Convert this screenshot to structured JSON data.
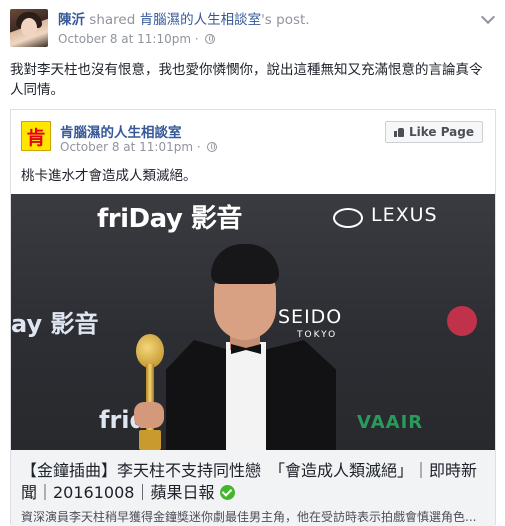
{
  "post": {
    "author": "陳沂",
    "shared_word": "shared",
    "shared_page": "肯腦濕的人生相談室",
    "post_suffix": "'s post.",
    "timestamp": "October 8 at 11:10pm",
    "privacy_icon": "globe-icon",
    "text": "我對李天柱也沒有恨意，我也愛你憐憫你，說出這種無知又充滿恨意的言論真令人同情。"
  },
  "shared": {
    "page_logo_text": "肯",
    "page_name": "肯腦濕的人生相談室",
    "timestamp": "October 8 at 11:01pm",
    "like_label": "Like Page",
    "text": "桃卡進水才會造成人類滅絕。",
    "photo_text": {
      "friday1": "friDay 影音",
      "lexus": "LEXUS",
      "friday2": "ay 影音",
      "seido": "SEIDO",
      "tokyo": "TOKYO",
      "friday3": "frid",
      "evaair": "VAAIR"
    },
    "link_title": "【金鐘插曲】李天柱不支持同性戀　「會造成人類滅絕」｜即時新聞｜20161008｜蘋果日報",
    "link_desc": "資深演員李天柱稍早獲得金鐘獎迷你劇最佳男主角，他在受訪時表示拍戲會慎選角色..."
  },
  "colors": {
    "link_blue": "#365899",
    "muted": "#90949c",
    "verified_green": "#42b72a"
  }
}
